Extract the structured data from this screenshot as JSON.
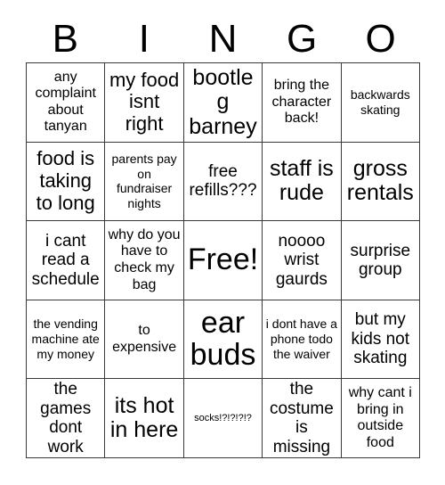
{
  "card": {
    "headers": [
      "B",
      "I",
      "N",
      "G",
      "O"
    ],
    "rows": [
      [
        {
          "text": "any complaint about tanyan",
          "size": "fs-sm"
        },
        {
          "text": "my food isnt right",
          "size": "fs-lg"
        },
        {
          "text": "bootleg barney",
          "size": "fs-xl"
        },
        {
          "text": "bring the character back!",
          "size": "fs-sm"
        },
        {
          "text": "backwards skating",
          "size": "fs-xs"
        }
      ],
      [
        {
          "text": "food is taking to long",
          "size": "fs-lg"
        },
        {
          "text": "parents pay on fundraiser nights",
          "size": "fs-xs"
        },
        {
          "text": "free refills???",
          "size": "fs-md"
        },
        {
          "text": "staff is rude",
          "size": "fs-xl"
        },
        {
          "text": "gross rentals",
          "size": "fs-xl"
        }
      ],
      [
        {
          "text": "i cant read a schedule",
          "size": "fs-md"
        },
        {
          "text": "why do you have to check my bag",
          "size": "fs-sm"
        },
        {
          "text": "Free!",
          "size": "fs-xxl"
        },
        {
          "text": "noooo wrist gaurds",
          "size": "fs-md"
        },
        {
          "text": "surprise group",
          "size": "fs-md"
        }
      ],
      [
        {
          "text": "the vending machine ate my money",
          "size": "fs-xs"
        },
        {
          "text": "to expensive",
          "size": "fs-sm"
        },
        {
          "text": "ear buds",
          "size": "fs-xxl"
        },
        {
          "text": "i dont have a phone todo the waiver",
          "size": "fs-xs"
        },
        {
          "text": "but my kids not skating",
          "size": "fs-md"
        }
      ],
      [
        {
          "text": "the games dont work",
          "size": "fs-md"
        },
        {
          "text": "its hot in here",
          "size": "fs-xl"
        },
        {
          "text": "socks!?!?!?!?",
          "size": "fs-xxs"
        },
        {
          "text": "the costume is missing",
          "size": "fs-md"
        },
        {
          "text": "why cant i bring in outside food",
          "size": "fs-sm"
        }
      ]
    ]
  }
}
